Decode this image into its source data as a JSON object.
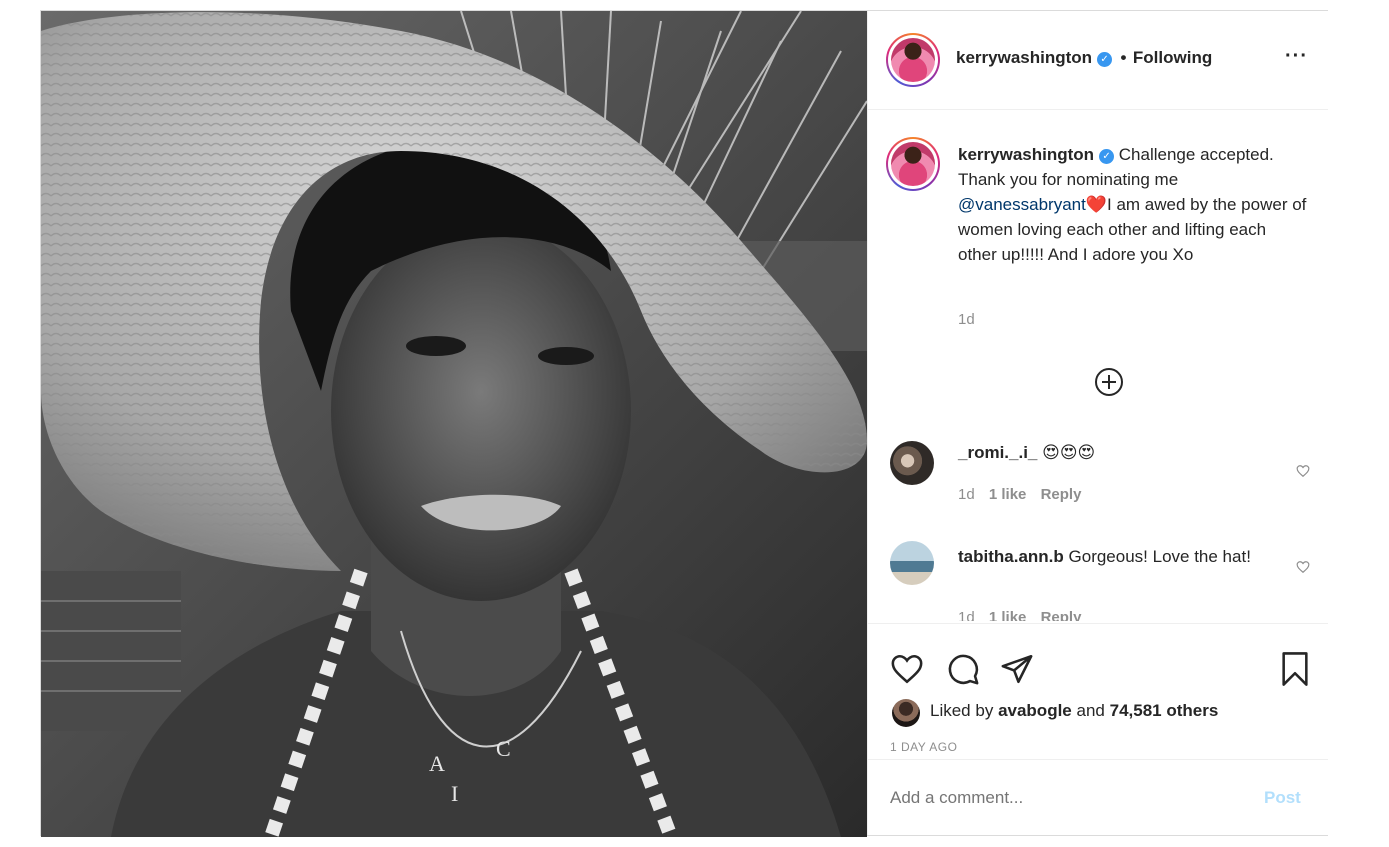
{
  "post": {
    "username": "kerrywashington",
    "follow_status": "Following",
    "more_icon": "more-options-icon",
    "photo_letters": [
      "A",
      "I",
      "C"
    ]
  },
  "caption": {
    "username": "kerrywashington",
    "text_before_mention": "Challenge accepted. Thank you for nominating me ",
    "mention": "@vanessabryant",
    "emoji": "❤️",
    "text_after_mention": "I am awed by the power of women loving each other and lifting each other up!!!!! And I adore you Xo",
    "time": "1d"
  },
  "load_more_icon": "plus-circle-icon",
  "comments": [
    {
      "username": "_romi._.i_",
      "text": "😍😍😍",
      "time": "1d",
      "likes": "1 like",
      "reply": "Reply"
    },
    {
      "username": "tabitha.ann.b",
      "text": "Gorgeous! Love the hat!",
      "time": "1d",
      "likes": "1 like",
      "reply": "Reply"
    }
  ],
  "actions": {
    "like_icon": "heart-icon",
    "comment_icon": "comment-icon",
    "share_icon": "share-icon",
    "save_icon": "bookmark-icon"
  },
  "likes": {
    "prefix": "Liked by",
    "user": "avabogle",
    "joiner": "and",
    "others": "74,581 others"
  },
  "timestamp": "1 DAY AGO",
  "add_comment": {
    "placeholder": "Add a comment...",
    "post_label": "Post"
  },
  "colors": {
    "link": "#00376b",
    "post_button_disabled": "#b2dffc",
    "verified": "#3897f0",
    "border": "#dbdbdb"
  }
}
